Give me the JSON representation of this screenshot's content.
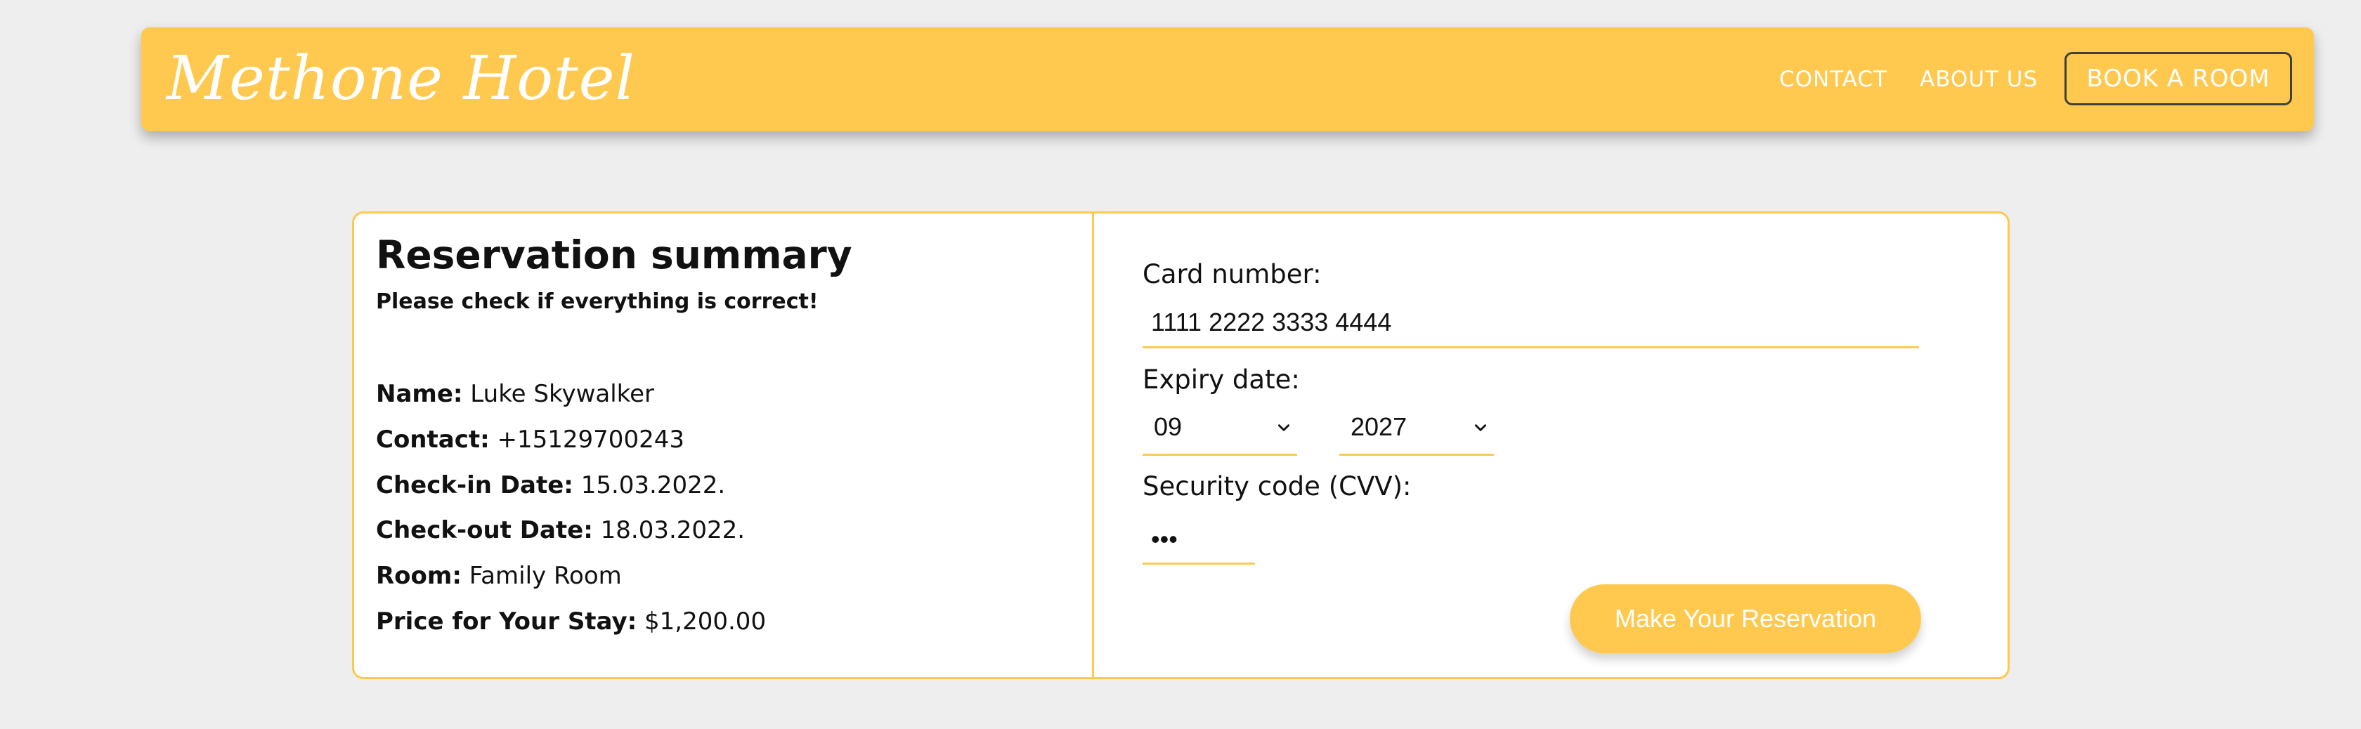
{
  "header": {
    "logo": "Methone Hotel",
    "nav": {
      "contact": "CONTACT",
      "about": "ABOUT US",
      "book": "BOOK A ROOM"
    }
  },
  "summary": {
    "title": "Reservation summary",
    "subtitle": "Please check if everything is correct!",
    "details": [
      {
        "label": "Name:",
        "value": "Luke Skywalker"
      },
      {
        "label": "Contact:",
        "value": "+15129700243"
      },
      {
        "label": "Check-in Date:",
        "value": "15.03.2022."
      },
      {
        "label": "Check-out Date:",
        "value": "18.03.2022."
      },
      {
        "label": "Room:",
        "value": "Family Room"
      },
      {
        "label": "Price for Your Stay:",
        "value": "$1,200.00"
      }
    ]
  },
  "payment": {
    "card_label": "Card number:",
    "card_value": "1111 2222 3333 4444",
    "expiry_label": "Expiry date:",
    "expiry_month": "09",
    "expiry_year": "2027",
    "cvv_label": "Security code (CVV):",
    "cvv_value": "•••",
    "submit_label": "Make Your Reservation"
  },
  "colors": {
    "accent": "#ffc94f",
    "background": "#eeeeee"
  }
}
